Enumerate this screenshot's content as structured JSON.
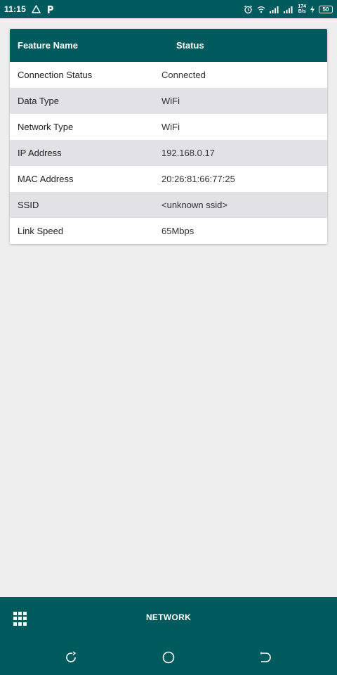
{
  "status_bar": {
    "time": "11:15",
    "net_speed_value": "174",
    "net_speed_unit": "B/s",
    "battery": "50"
  },
  "table": {
    "headers": {
      "feature": "Feature Name",
      "status": "Status"
    },
    "rows": [
      {
        "feature": "Connection Status",
        "status": "Connected"
      },
      {
        "feature": "Data Type",
        "status": "WiFi"
      },
      {
        "feature": "Network Type",
        "status": "WiFi"
      },
      {
        "feature": "IP Address",
        "status": "192.168.0.17"
      },
      {
        "feature": "MAC Address",
        "status": "20:26:81:66:77:25"
      },
      {
        "feature": "SSID",
        "status": "<unknown ssid>"
      },
      {
        "feature": "Link Speed",
        "status": "65Mbps"
      }
    ]
  },
  "bottom_bar": {
    "title": "NETWORK",
    "menu_icon": "grid-icon"
  },
  "system_nav": {
    "recents_icon": "recents-icon",
    "home_icon": "home-icon",
    "back_icon": "back-icon"
  },
  "colors": {
    "primary": "#005b5f",
    "background": "#eeeeee",
    "row_alt": "#e2e2e5"
  }
}
